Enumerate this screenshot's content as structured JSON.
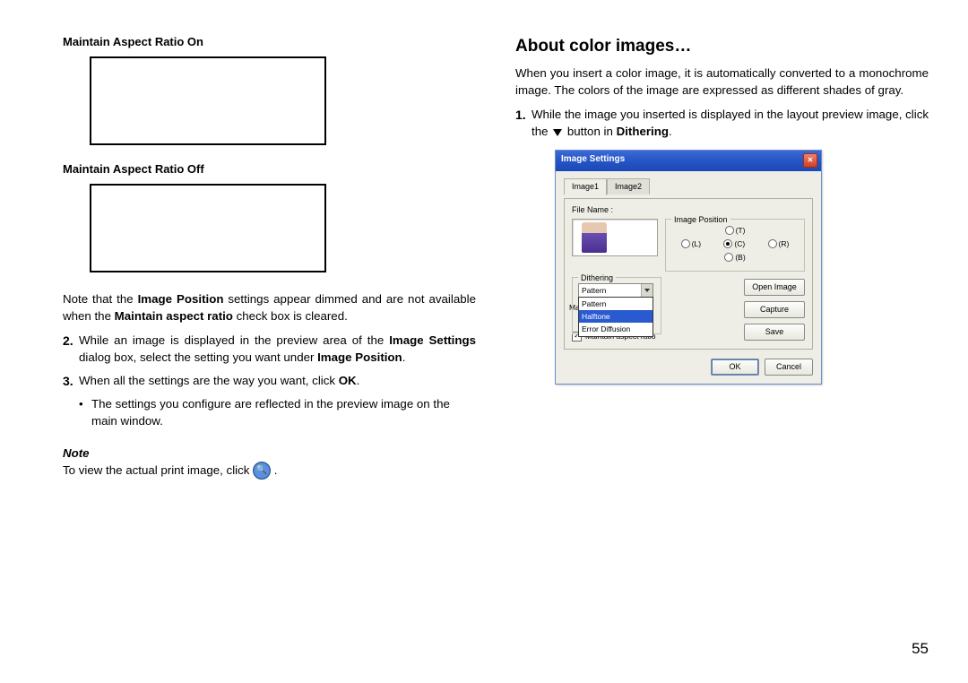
{
  "left": {
    "aspect_on": "Maintain Aspect Ratio On",
    "aspect_off": "Maintain Aspect Ratio Off",
    "note_para_pre": "Note that the ",
    "image_position": "Image Position",
    "note_para_mid": " settings appear dimmed and are not available when the ",
    "maintain_aspect_ratio": "Maintain aspect ratio",
    "note_para_end": " check box is cleared.",
    "step2_num": "2.",
    "step2_pre": "While an image is displayed in the preview area of the ",
    "image_settings": "Image Settings",
    "step2_mid": " dialog box, select the setting you want under ",
    "step2_end": ".",
    "step3_num": "3.",
    "step3_pre": "When all the settings are the way you want, click ",
    "ok_bold": "OK",
    "step3_end": ".",
    "bullet1": "The settings you configure are reflected in the preview image on the main window.",
    "note_heading": "Note",
    "note_text_pre": "To view the actual print image, click ",
    "note_text_end": " ."
  },
  "right": {
    "title": "About color images…",
    "intro": "When you insert a color image, it is automatically converted to a monochrome image. The colors of the image are expressed as different shades of gray.",
    "step1_num": "1.",
    "step1_pre": "While the image you inserted is displayed in the layout preview image, click the ",
    "step1_mid": " button in ",
    "dithering_bold": "Dithering",
    "step1_end": "."
  },
  "dialog": {
    "title": "Image Settings",
    "tab1": "Image1",
    "tab2": "Image2",
    "file_name_label": "File Name :",
    "fieldset_image_position": "Image Position",
    "radio_T": "(T)",
    "radio_L": "(L)",
    "radio_C": "(C)",
    "radio_R": "(R)",
    "radio_B": "(B)",
    "fieldset_dithering": "Dithering",
    "combo_value": "Pattern",
    "combo_opt1": "Pattern",
    "combo_opt2": "Halftone",
    "combo_opt3": "Error Diffusion",
    "maintain_label_prefix": "Maintai",
    "maintain_checkbox": "Maintain aspect ratio",
    "checkmark": "✓",
    "btn_open": "Open Image",
    "btn_capture": "Capture",
    "btn_save": "Save",
    "btn_ok": "OK",
    "btn_cancel": "Cancel"
  },
  "page_number": "55"
}
